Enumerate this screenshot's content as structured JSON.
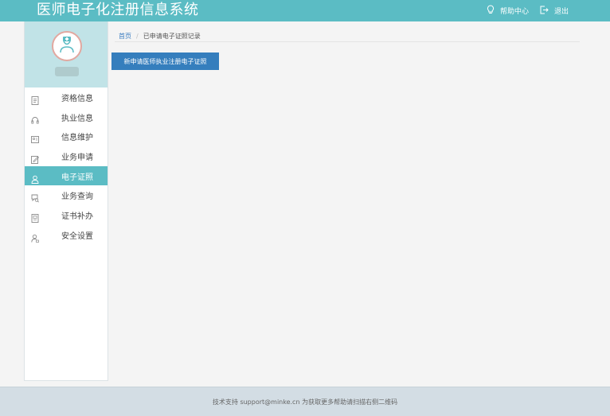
{
  "header": {
    "title": "医师电子化注册信息系统",
    "actions": [
      {
        "label": "帮助中心",
        "icon": "lightbulb-icon"
      },
      {
        "label": "退出",
        "icon": "logout-icon"
      }
    ]
  },
  "sidebar": {
    "items": [
      {
        "label": "资格信息",
        "icon": "document-icon",
        "active": false
      },
      {
        "label": "执业信息",
        "icon": "headset-icon",
        "active": false
      },
      {
        "label": "信息维护",
        "icon": "id-card-icon",
        "active": false
      },
      {
        "label": "业务申请",
        "icon": "edit-icon",
        "active": false
      },
      {
        "label": "电子证照",
        "icon": "user-badge-icon",
        "active": true
      },
      {
        "label": "业务查询",
        "icon": "chat-search-icon",
        "active": false
      },
      {
        "label": "证书补办",
        "icon": "certificate-icon",
        "active": false
      },
      {
        "label": "安全设置",
        "icon": "user-lock-icon",
        "active": false
      }
    ]
  },
  "breadcrumb": {
    "home": "首页",
    "separator": "/",
    "current": "已申请电子证照记录"
  },
  "main": {
    "primary_button": "新申请医师执业注册电子证照"
  },
  "footer": {
    "text": "技术支持 support@minke.cn 为获取更多帮助请扫描右侧二维码"
  },
  "colors": {
    "header_bg": "#5bbcc4",
    "active_item": "#5bbcc4",
    "primary_button": "#357ebd",
    "footer_bg": "#d3dde4"
  }
}
